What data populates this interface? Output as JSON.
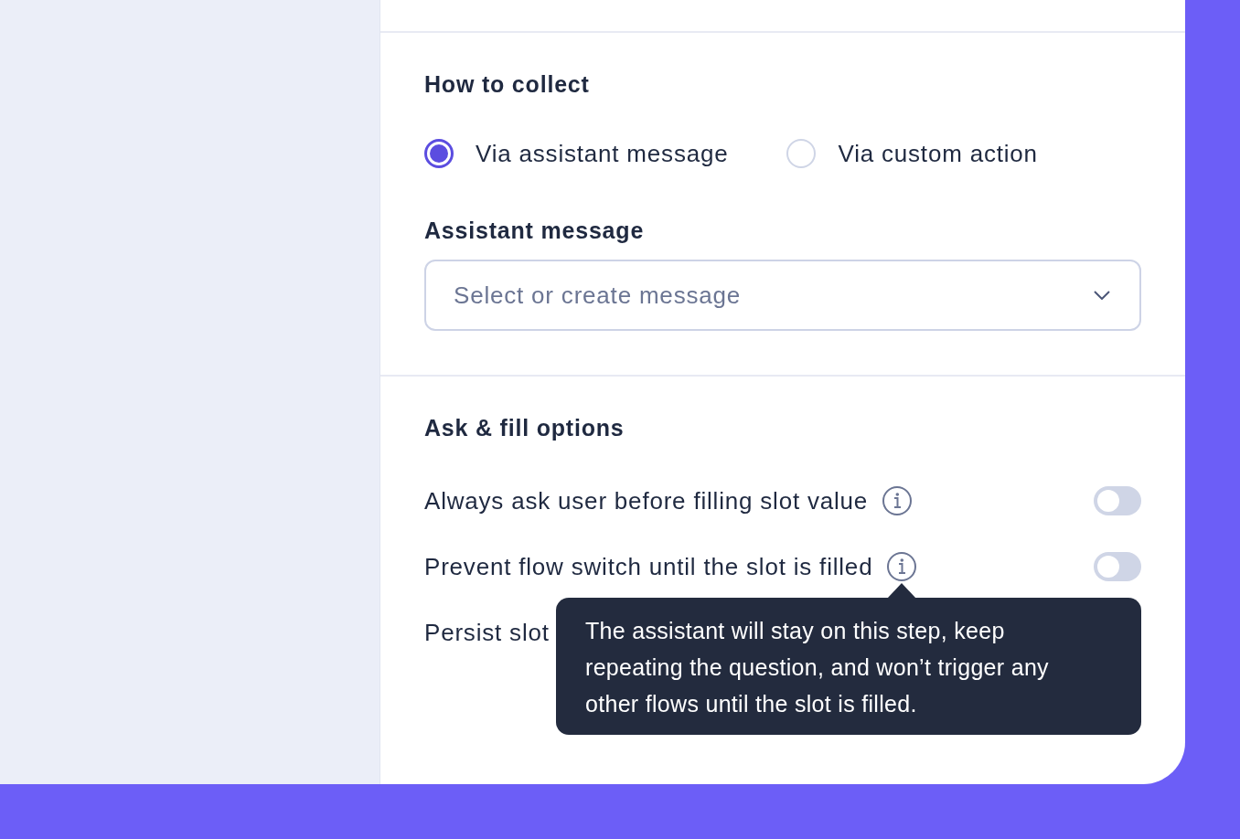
{
  "collect": {
    "heading": "How to collect",
    "options": [
      {
        "label": "Via assistant message",
        "selected": true
      },
      {
        "label": "Via custom action",
        "selected": false
      }
    ],
    "message_label": "Assistant message",
    "message_select": {
      "placeholder": "Select or create message"
    }
  },
  "ask_fill": {
    "heading": "Ask & fill options",
    "options": [
      {
        "kind": "toggle",
        "label": "Always ask user before filling slot value",
        "on": false
      },
      {
        "kind": "toggle",
        "label": "Prevent flow switch until the slot is filled",
        "on": false,
        "tooltip": "The assistant will stay on this step, keep repeating the question, and won’t trigger any other flows until the slot is filled."
      },
      {
        "kind": "plain",
        "label": "Persist slot"
      }
    ]
  }
}
